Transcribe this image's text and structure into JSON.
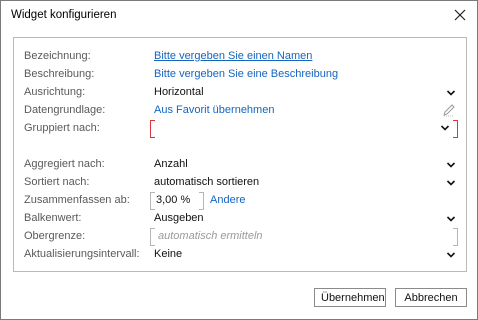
{
  "dialog": {
    "title": "Widget konfigurieren"
  },
  "fields": {
    "bezeichnung": {
      "label": "Bezeichnung:",
      "value": "Bitte vergeben Sie einen Namen"
    },
    "beschreibung": {
      "label": "Beschreibung:",
      "value": "Bitte vergeben Sie eine Beschreibung"
    },
    "ausrichtung": {
      "label": "Ausrichtung:",
      "value": "Horizontal"
    },
    "datengrundlage": {
      "label": "Datengrundlage:",
      "value": "Aus Favorit übernehmen"
    },
    "gruppiert": {
      "label": "Gruppiert nach:",
      "value": ""
    },
    "aggregiert": {
      "label": "Aggregiert nach:",
      "value": "Anzahl"
    },
    "sortiert": {
      "label": "Sortiert nach:",
      "value": "automatisch sortieren"
    },
    "zusammenfassen": {
      "label": "Zusammenfassen ab:",
      "value": "3,00 %",
      "link": "Andere"
    },
    "balkenwert": {
      "label": "Balkenwert:",
      "value": "Ausgeben"
    },
    "obergrenze": {
      "label": "Obergrenze:",
      "placeholder": "automatisch ermitteln"
    },
    "intervall": {
      "label": "Aktualisierungsintervall:",
      "value": "Keine"
    }
  },
  "buttons": {
    "ok": "Übernehmen",
    "cancel": "Abbrechen"
  },
  "icons": {
    "close": "close-icon",
    "dropdown": "chevron-down-icon",
    "edit": "pencil-icon"
  },
  "colors": {
    "link": "#1565c0",
    "error": "#d9363e"
  }
}
